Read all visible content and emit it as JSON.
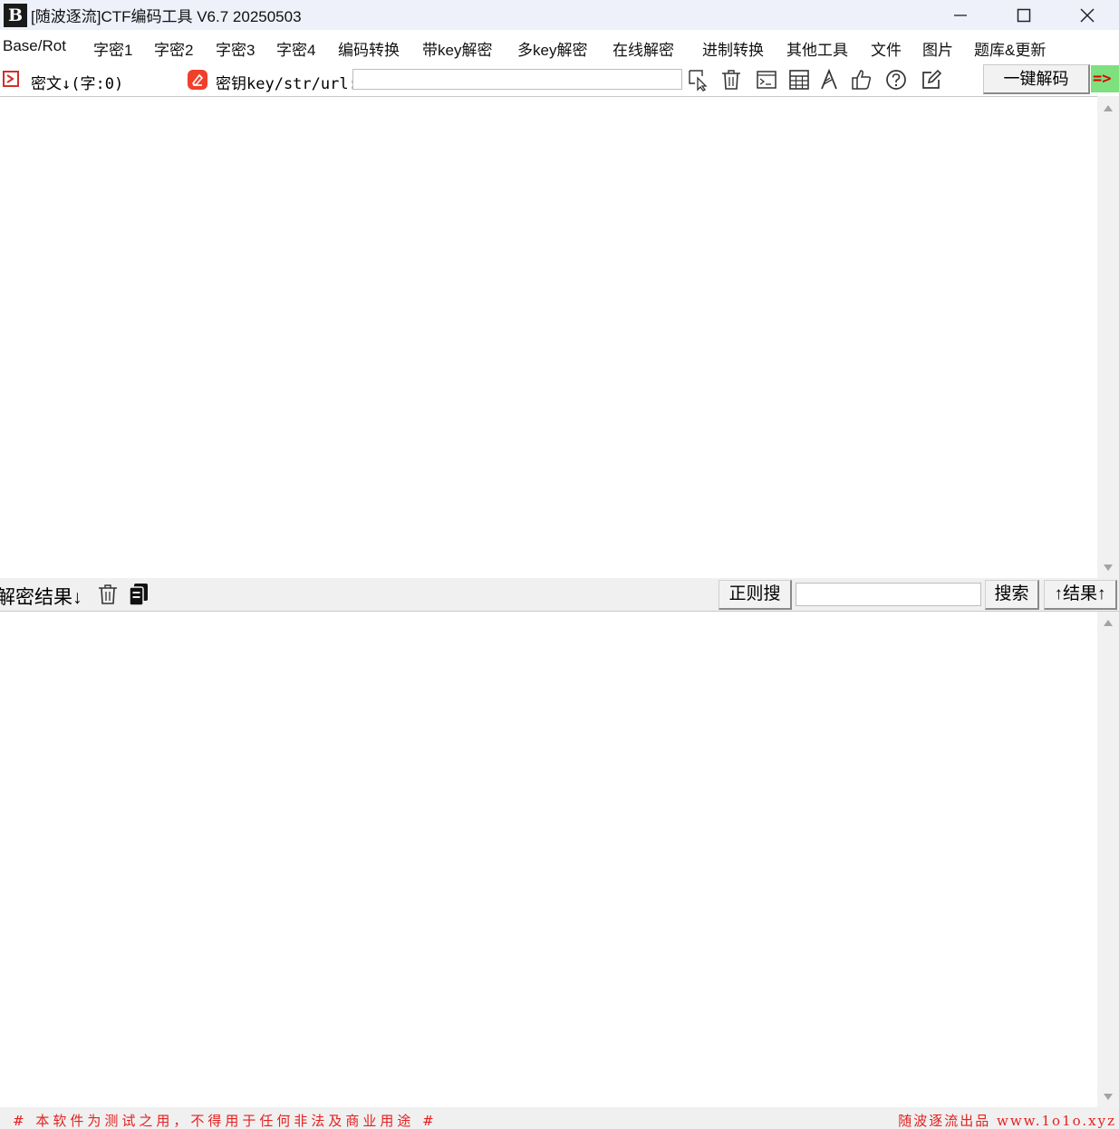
{
  "window": {
    "logo_text": "B",
    "title": "[随波逐流]CTF编码工具 V6.7  20250503"
  },
  "menu": {
    "items": [
      "Base/Rot",
      "字密1",
      "字密2",
      "字密3",
      "字密4",
      "编码转换",
      "带key解密",
      "多key解密",
      "在线解密",
      "进制转换",
      "其他工具",
      "文件",
      "图片",
      "题库&更新"
    ]
  },
  "toolbar": {
    "cipher_label": "密文↓(字:0)",
    "key_label": "密钥key/str/url:",
    "key_value": "",
    "decode_button": "一键解码",
    "arrow_button": "=>",
    "icons": [
      "select-cursor-icon",
      "trash-icon",
      "terminal-icon",
      "calculator-icon",
      "font-icon",
      "thumbs-up-icon",
      "help-icon",
      "edit-icon"
    ]
  },
  "input_pane": {
    "value": ""
  },
  "result": {
    "label": "解密结果↓",
    "regex_button": "正则搜",
    "search_value": "",
    "search_button": "搜索",
    "up_button": "↑结果↑"
  },
  "output_pane": {
    "value": ""
  },
  "footer": {
    "left": "# 本软件为测试之用，不得用于任何非法及商业用途 #",
    "right": "随波逐流出品 www.1o1o.xyz"
  },
  "colors": {
    "footer_text": "#e52020",
    "arrow_bg": "#7ee07e",
    "arrow_fg": "#e00000",
    "key_icon": "#f0402a"
  }
}
